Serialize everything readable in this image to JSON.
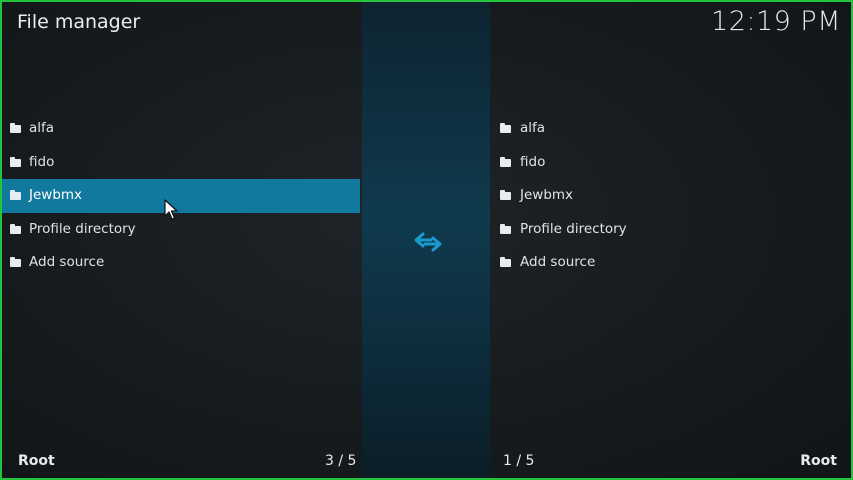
{
  "header": {
    "title": "File manager",
    "clock": "12:19 PM"
  },
  "left_pane": {
    "items": [
      {
        "label": "alfa",
        "icon": "folder-icon"
      },
      {
        "label": "fido",
        "icon": "folder-icon"
      },
      {
        "label": "Jewbmx",
        "icon": "folder-icon",
        "selected": true
      },
      {
        "label": "Profile directory",
        "icon": "folder-icon"
      },
      {
        "label": "Add source",
        "icon": "folder-icon"
      }
    ],
    "location": "Root",
    "counter": "3 / 5"
  },
  "right_pane": {
    "items": [
      {
        "label": "alfa",
        "icon": "folder-icon"
      },
      {
        "label": "fido",
        "icon": "folder-icon"
      },
      {
        "label": "Jewbmx",
        "icon": "folder-icon"
      },
      {
        "label": "Profile directory",
        "icon": "folder-icon"
      },
      {
        "label": "Add source",
        "icon": "folder-icon"
      }
    ],
    "location": "Root",
    "counter": "1 / 5"
  },
  "center": {
    "icon": "swap-arrows-icon",
    "accent": "#1a9bd0"
  },
  "colors": {
    "selection": "#12799e",
    "frame_border": "#22c43c"
  }
}
